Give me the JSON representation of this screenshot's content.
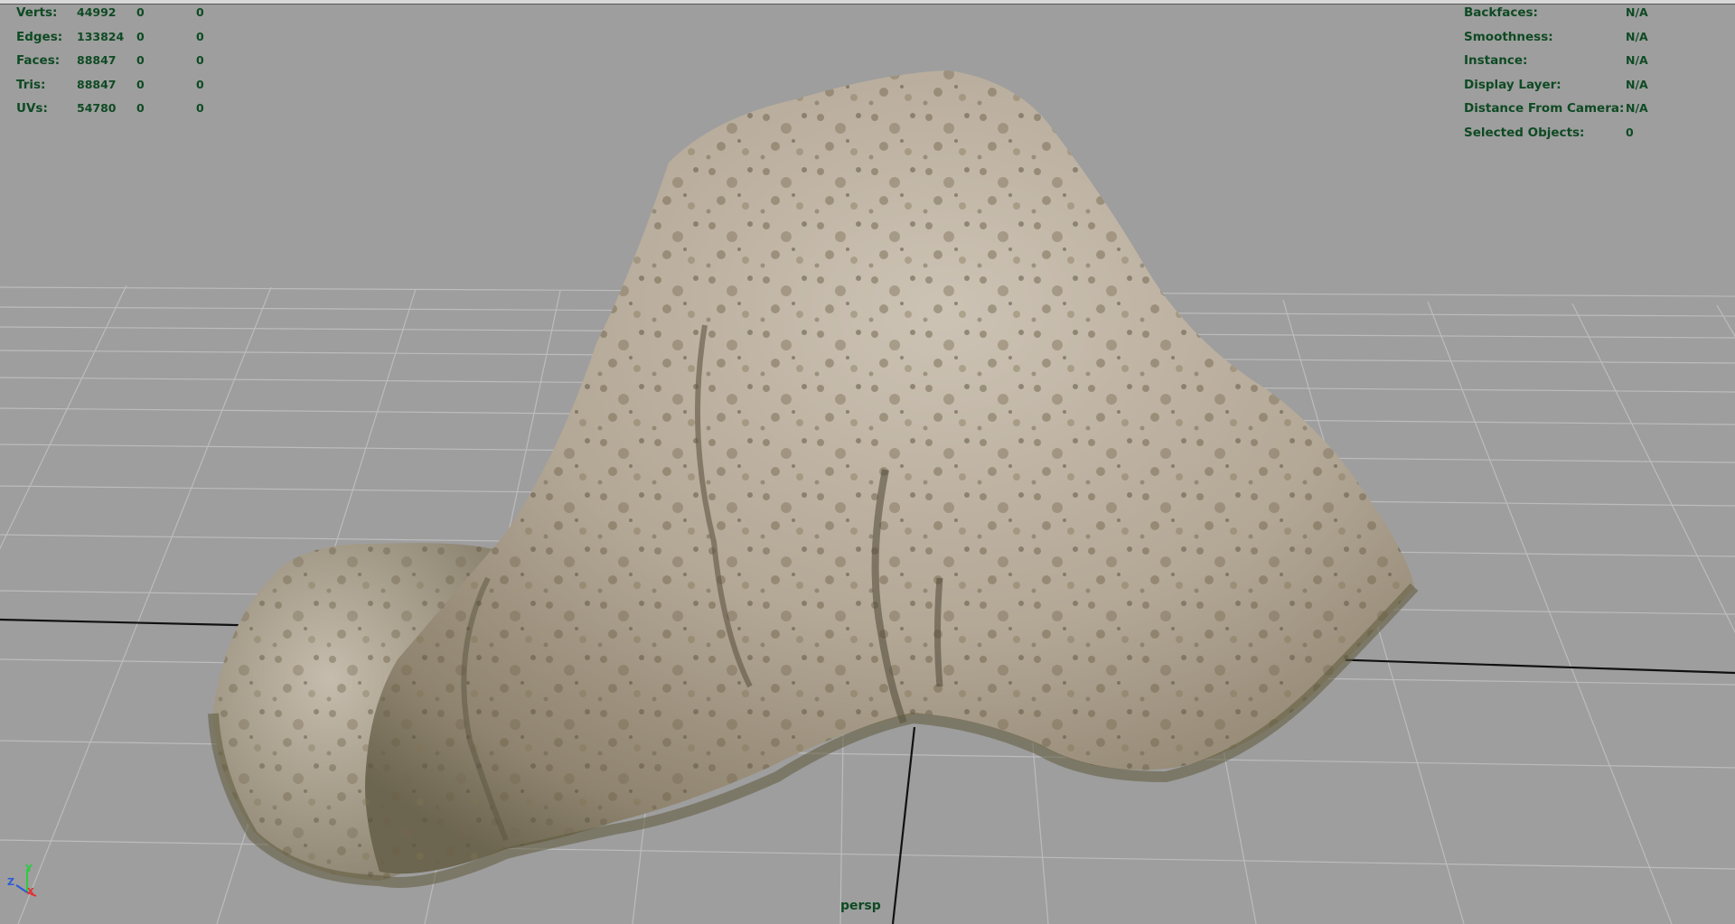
{
  "hud_stats": [
    {
      "label": "Verts:",
      "value": "44992",
      "selected": "0",
      "uv": "0"
    },
    {
      "label": "Edges:",
      "value": "133824",
      "selected": "0",
      "uv": "0"
    },
    {
      "label": "Faces:",
      "value": "88847",
      "selected": "0",
      "uv": "0"
    },
    {
      "label": "Tris:",
      "value": "88847",
      "selected": "0",
      "uv": "0"
    },
    {
      "label": "UVs:",
      "value": "54780",
      "selected": "0",
      "uv": "0"
    }
  ],
  "hud_info": [
    {
      "label": "Backfaces:",
      "value": "N/A"
    },
    {
      "label": "Smoothness:",
      "value": "N/A"
    },
    {
      "label": "Instance:",
      "value": "N/A"
    },
    {
      "label": "Display Layer:",
      "value": "N/A"
    },
    {
      "label": "Distance From Camera:",
      "value": "N/A"
    },
    {
      "label": "Selected Objects:",
      "value": "0"
    }
  ],
  "camera_label": "persp",
  "axis": {
    "y": "Y",
    "z": "Z",
    "x": "X"
  },
  "colors": {
    "background": "#9e9e9e",
    "grid": "#bcbcbc",
    "hud_text": "#0e4a23",
    "axis_x": "#e03030",
    "axis_y": "#2ecc40",
    "axis_z": "#2a5bd7"
  }
}
